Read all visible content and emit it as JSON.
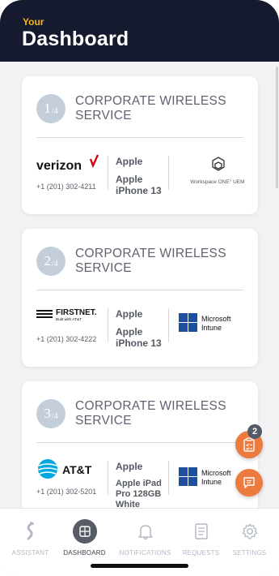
{
  "header": {
    "subtitle": "Your",
    "title": "Dashboard"
  },
  "cards": [
    {
      "index": "1",
      "total": "/4",
      "title": "CORPORATE WIRELESS SERVICE",
      "carrier": "verizon",
      "phone": "+1 (201) 302-4211",
      "brand": "Apple",
      "model": "Apple iPhone 13",
      "mdm_name": "Workspace ONE° UEM"
    },
    {
      "index": "2",
      "total": "/4",
      "title": "CORPORATE WIRELESS SERVICE",
      "carrier": "FIRSTNET.",
      "carrier_tagline": "Built with AT&T",
      "phone": "+1 (201) 302-4222",
      "brand": "Apple",
      "model": "Apple iPhone 13",
      "mdm_name": "Microsoft Intune"
    },
    {
      "index": "3",
      "total": "/4",
      "title": "CORPORATE WIRELESS SERVICE",
      "carrier": "AT&T",
      "phone": "+1 (201) 302-5201",
      "brand": "Apple",
      "model": "Apple iPad Pro 128GB White",
      "mdm_name": "Microsoft Intune"
    }
  ],
  "fab": {
    "badge_count": "2"
  },
  "tabs": [
    {
      "label": "ASSISTANT",
      "icon": "assistant-icon"
    },
    {
      "label": "DASHBOARD",
      "icon": "dashboard-icon",
      "active": true
    },
    {
      "label": "NOTIFICATIONS",
      "icon": "bell-icon"
    },
    {
      "label": "REQUESTS",
      "icon": "document-icon"
    },
    {
      "label": "SETTINGS",
      "icon": "gear-icon"
    }
  ],
  "colors": {
    "header_bg": "#161a2e",
    "accent_yellow": "#f3b71b",
    "fab_orange": "#ed7a3f",
    "verizon_red": "#cd040b",
    "att_blue": "#00a8e0",
    "intune_blue": "#1d4fa0"
  }
}
